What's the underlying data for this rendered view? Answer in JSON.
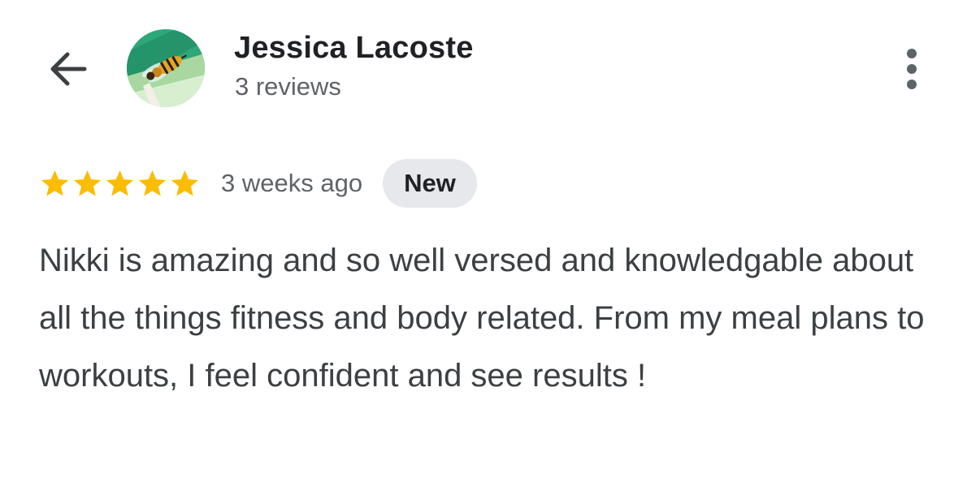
{
  "reviewer": {
    "name": "Jessica Lacoste",
    "review_count": "3 reviews",
    "avatar_icon": "wasp-avatar"
  },
  "navigation": {
    "back_icon": "arrow-left-icon",
    "menu_icon": "more-vertical-icon"
  },
  "review": {
    "rating": 5,
    "max_rating": 5,
    "time_ago": "3 weeks ago",
    "badge": "New",
    "text": "Nikki is amazing and so well versed and knowledgable about all the things fitness and body related. From my meal plans to workouts, I feel confident and see results !"
  },
  "colors": {
    "star": "#fbbc04",
    "badge_bg": "#e6e8eb",
    "secondary_text": "#5f6368"
  }
}
